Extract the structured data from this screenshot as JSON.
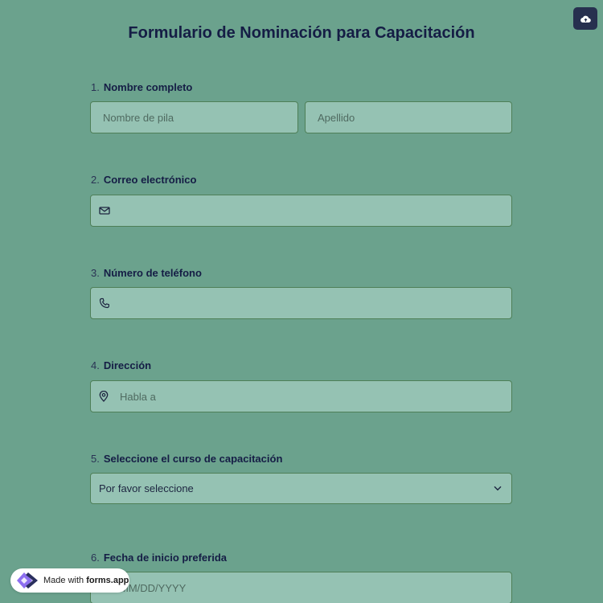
{
  "header": {
    "title": "Formulario de Nominación para Capacitación",
    "save_icon": "cloud-upload-icon"
  },
  "questions": [
    {
      "number": "1.",
      "label": "Nombre completo",
      "first_placeholder": "Nombre de pila",
      "last_placeholder": "Apellido"
    },
    {
      "number": "2.",
      "label": "Correo electrónico",
      "placeholder": "",
      "icon": "mail-icon"
    },
    {
      "number": "3.",
      "label": "Número de teléfono",
      "placeholder": "",
      "icon": "phone-icon"
    },
    {
      "number": "4.",
      "label": "Dirección",
      "placeholder": "Habla a",
      "icon": "map-pin-icon"
    },
    {
      "number": "5.",
      "label": "Seleccione el curso de capacitación",
      "selected": "Por favor seleccione",
      "icon": "chevron-down-icon"
    },
    {
      "number": "6.",
      "label": "Fecha de inicio preferida",
      "placeholder": "MM/DD/YYYY"
    }
  ],
  "badge": {
    "prefix": "Made with",
    "brand": "forms.app",
    "icon": "forms-app-logo-icon"
  },
  "colors": {
    "background": "#6ba28d",
    "field": "#95c2b3",
    "field_border": "#4e7f57",
    "text": "#151d45",
    "save_button": "#27304f"
  }
}
